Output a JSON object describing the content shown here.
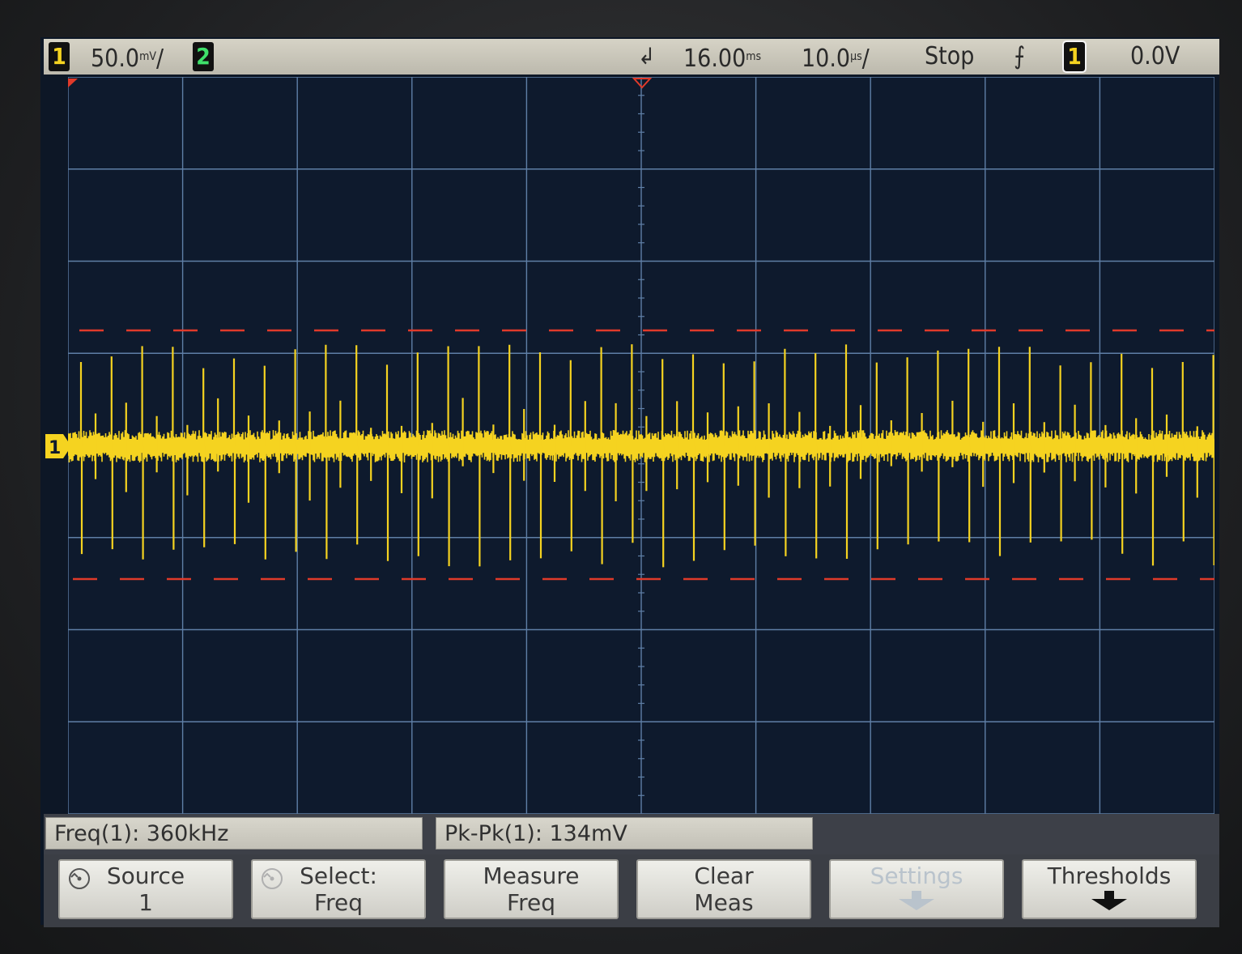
{
  "status_bar": {
    "ch1_badge": "1",
    "ch1_scale": "50.0",
    "ch1_unit_stack": "mV",
    "ch1_suffix": "/",
    "ch2_badge": "2",
    "trigger_marker_glyph": "↲",
    "delay_value": "16.00",
    "delay_unit_stack": "ms",
    "timebase_value": "10.0",
    "timebase_unit_stack": "µs",
    "timebase_suffix": "/",
    "run_state": "Stop",
    "trigger_slope_glyph": "⨍",
    "trigger_source_badge": "1",
    "trigger_level": "0.0V"
  },
  "screen": {
    "ch1_ground_marker": "1",
    "trace_color": "#f5d320",
    "cursor_color": "#e03a2a",
    "grid_color": "#5f7fa6",
    "background_color": "#0e1a2d"
  },
  "measurements": [
    {
      "label": "Freq(1): 360kHz"
    },
    {
      "label": "Pk-Pk(1): 134mV"
    }
  ],
  "softkeys": [
    {
      "line1": "Source",
      "line2": "1",
      "icon": "knob-icon",
      "state": "enabled"
    },
    {
      "line1": "Select:",
      "line2": "Freq",
      "icon": "knob-icon",
      "state": "enabled"
    },
    {
      "line1": "Measure",
      "line2": "Freq",
      "icon": "",
      "state": "enabled"
    },
    {
      "line1": "Clear",
      "line2": "Meas",
      "icon": "",
      "state": "enabled"
    },
    {
      "line1": "Settings",
      "line2": "",
      "icon": "down-arrow-icon",
      "state": "disabled"
    },
    {
      "line1": "Thresholds",
      "line2": "",
      "icon": "down-arrow-icon",
      "state": "enabled"
    }
  ]
}
